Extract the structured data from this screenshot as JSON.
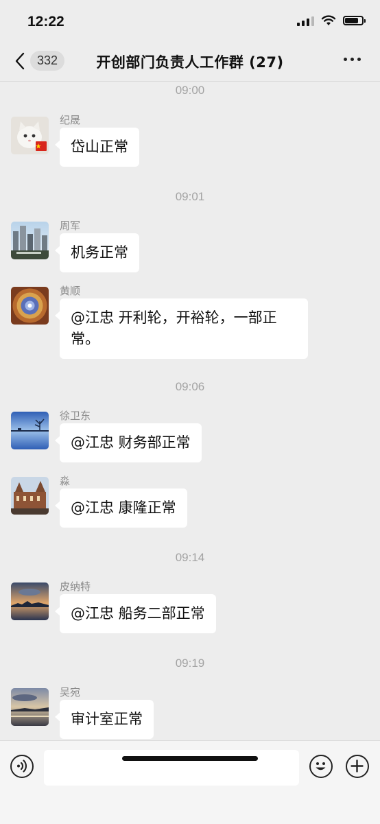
{
  "status_bar": {
    "time": "12:22",
    "battery_level": 0.8
  },
  "nav": {
    "unread_count": "332",
    "title": "开创部门负责人工作群 (27)"
  },
  "messages": [
    {
      "type": "time",
      "text": "09:00"
    },
    {
      "type": "msg",
      "sender": "纪晟",
      "text": "岱山正常",
      "avatar": "white-cat-avatar"
    },
    {
      "type": "time",
      "text": "09:01"
    },
    {
      "type": "msg",
      "sender": "周军",
      "text": "机务正常",
      "avatar": "city-skyline-avatar"
    },
    {
      "type": "msg",
      "sender": "黄顺",
      "text": "@江忠 开利轮，开裕轮，一部正常。",
      "avatar": "dome-ceiling-avatar"
    },
    {
      "type": "time",
      "text": "09:06"
    },
    {
      "type": "msg",
      "sender": "徐卫东",
      "text": "@江忠 财务部正常",
      "avatar": "lake-tree-avatar"
    },
    {
      "type": "msg",
      "sender": "淼",
      "text": "@江忠 康隆正常",
      "avatar": "old-building-avatar"
    },
    {
      "type": "time",
      "text": "09:14"
    },
    {
      "type": "msg",
      "sender": "皮纳特",
      "text": "@江忠 船务二部正常",
      "avatar": "harbor-sunset-avatar"
    },
    {
      "type": "time",
      "text": "09:19"
    },
    {
      "type": "msg",
      "sender": "吴宛",
      "text": "审计室正常",
      "avatar": "seaside-dusk-avatar"
    }
  ],
  "input": {
    "value": ""
  },
  "colors": {
    "background": "#ededed",
    "bubble": "#ffffff",
    "timestamp": "#a3a3a3"
  }
}
